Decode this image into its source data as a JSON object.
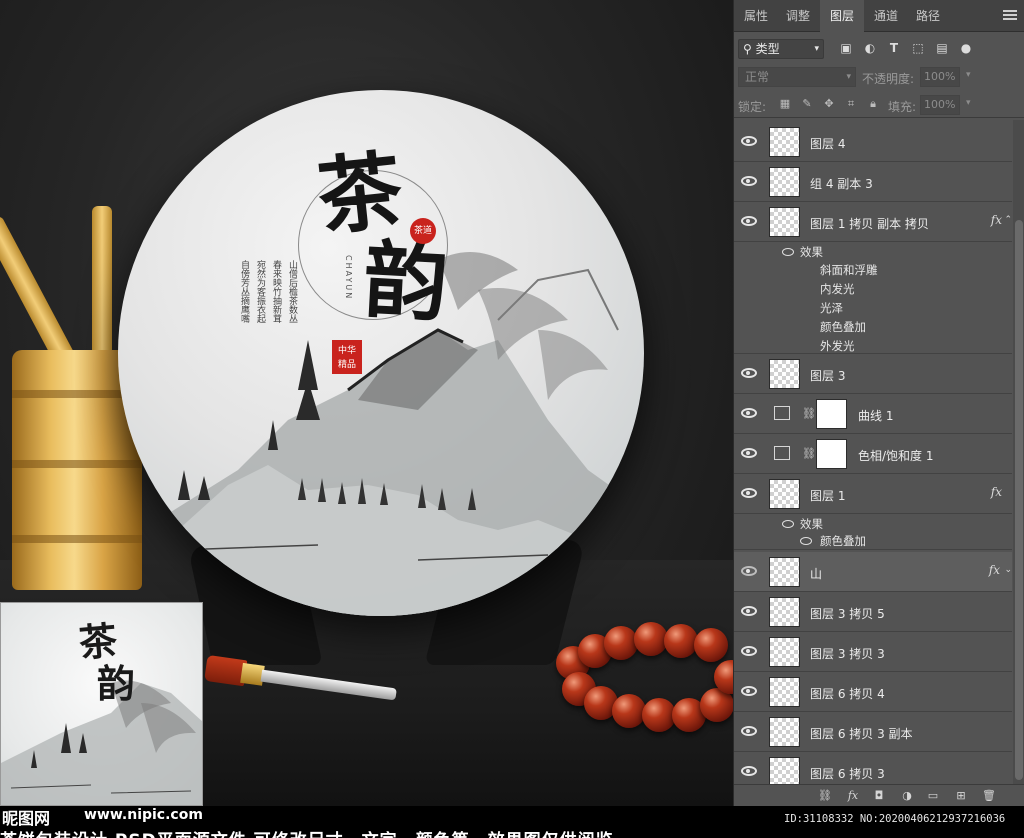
{
  "canvas": {
    "tea_title_1": "茶",
    "tea_title_2": "韵",
    "seal_small": "茶道",
    "seal_big": "中华精品",
    "pinyin": "CHAYUN",
    "poem_cols": [
      "山僧后檐茶数丛",
      "春来映竹抽新茸",
      "宛然为客振衣起",
      "自傍芳丛摘鹰嘴"
    ]
  },
  "thumbnail": {
    "t1": "茶",
    "t2": "韵"
  },
  "watermark": {
    "logo": "昵图网",
    "url": "www.nipic.com",
    "id": "ID:31108332 NO:20200406212937216036",
    "caption": "茶饼包装设计 PSD平面源文件 可修改尺寸、文字、颜色等，效果图仅供阅览"
  },
  "panel": {
    "tabs": [
      "属性",
      "调整",
      "图层",
      "通道",
      "路径"
    ],
    "active_tab": "图层",
    "filter": {
      "label": "类型",
      "icons": [
        "image-filter-icon",
        "adjustment-filter-icon",
        "text-filter-icon",
        "shape-filter-icon",
        "smart-object-filter-icon",
        "filter-toggle-icon"
      ]
    },
    "blend_mode": "正常",
    "opacity_label": "不透明度:",
    "opacity_value": "100%",
    "lock_label": "锁定:",
    "fill_label": "填充:",
    "fill_value": "100%",
    "layers": [
      {
        "name": "图层 4",
        "fx": false
      },
      {
        "name": "组 4 副本 3",
        "fx": false
      },
      {
        "name": "图层 1 拷贝 副本 拷贝",
        "fx": true,
        "fx_label": "fx"
      }
    ],
    "effects_1": {
      "head": "效果",
      "items": [
        "斜面和浮雕",
        "内发光",
        "光泽",
        "颜色叠加",
        "外发光"
      ]
    },
    "layers_2": [
      {
        "name": "图层 3"
      }
    ],
    "adjustments": [
      {
        "name": "曲线 1",
        "icon": "curves-icon"
      },
      {
        "name": "色相/饱和度 1",
        "icon": "hue-saturation-icon"
      }
    ],
    "layer_fx": {
      "name": "图层 1",
      "fx_label": "fx"
    },
    "effects_2": {
      "head": "效果",
      "items": [
        "颜色叠加"
      ]
    },
    "layers_3": [
      {
        "name": "山",
        "fx_label": "fx",
        "selected": true
      },
      {
        "name": "图层 3 拷贝 5"
      },
      {
        "name": "图层 3 拷贝 3"
      },
      {
        "name": "图层 6 拷贝 4"
      },
      {
        "name": "图层 6 拷贝 3 副本"
      },
      {
        "name": "图层 6 拷贝 3"
      }
    ],
    "bottom_icons": [
      "link-layers-icon",
      "fx-icon",
      "add-mask-icon",
      "adjustment-layer-icon",
      "new-group-icon",
      "new-layer-icon",
      "trash-icon"
    ]
  }
}
